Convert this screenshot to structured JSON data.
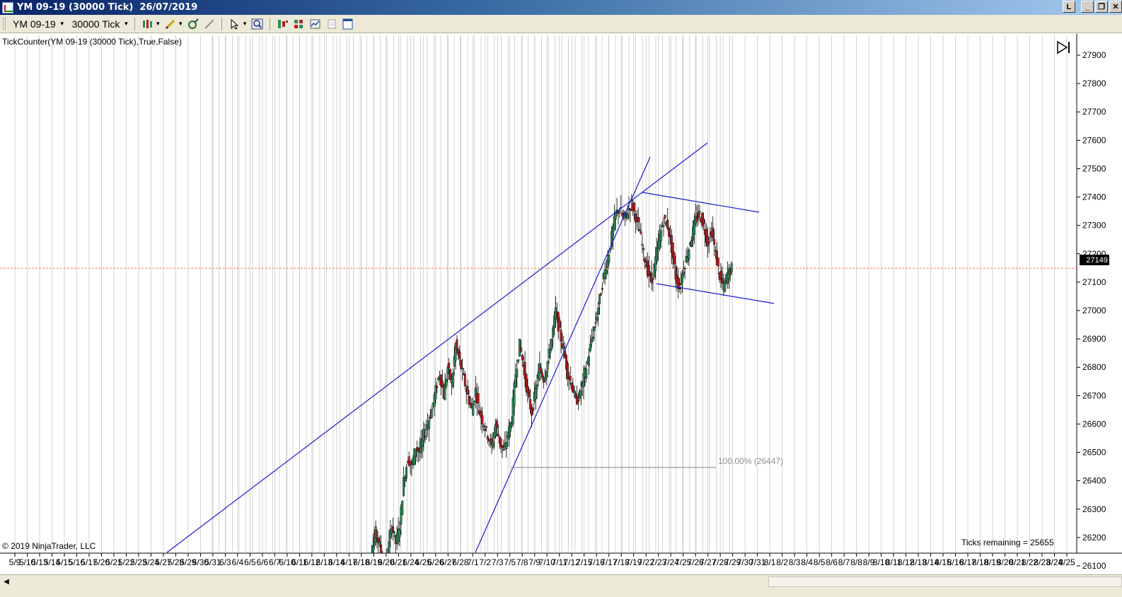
{
  "window": {
    "title": "YM 09-19 (30000 Tick)  26/07/2019",
    "buttons": [
      "L",
      "_",
      "❐",
      "✕"
    ]
  },
  "toolbar": {
    "instrument": "YM 09-19",
    "period": "30000 Tick",
    "icons": [
      "bars-type-icon",
      "draw-pencil-icon",
      "indicator-icon",
      "strategy-icon",
      "pointer-icon",
      "zoom-icon",
      "data-box-icon",
      "chart-trader-icon",
      "properties-icon",
      "template-icon",
      "window-icon"
    ]
  },
  "chart": {
    "indicator_label": "TickCounter(YM 09-19 (30000 Tick),True,False)",
    "copyright": "© 2019 NinjaTrader, LLC",
    "ticks_remaining": "Ticks remaining = 25655",
    "current_price": "27149",
    "fib_label": "100.00% (26447)",
    "colors": {
      "trendline": "#1a1ad2",
      "up_candle": "#2e8b57",
      "down_candle": "#b22222",
      "price_line": "#ff8040",
      "grid": "#c0c0c0"
    }
  },
  "chart_data": {
    "type": "candlestick",
    "price_axis": {
      "min": 26100,
      "max": 27900,
      "ticks": [
        "27900",
        "27800",
        "27700",
        "27600",
        "27500",
        "27400",
        "27300",
        "27200",
        "27100",
        "27000",
        "26900",
        "26800",
        "26700",
        "26600",
        "26500",
        "26400",
        "26300",
        "26200",
        "26100"
      ]
    },
    "date_axis": {
      "labels": [
        "5/9",
        "5/10",
        "5/13",
        "5/14",
        "5/15",
        "5/16",
        "5/17",
        "5/20",
        "5/21",
        "5/22",
        "5/23",
        "5/24",
        "5/27",
        "5/28",
        "5/29",
        "5/30",
        "5/31",
        "6/3",
        "6/4",
        "6/5",
        "6/6",
        "6/7",
        "6/10",
        "6/11",
        "6/12",
        "6/13",
        "6/14",
        "6/17",
        "6/18",
        "6/19",
        "6/20",
        "6/21",
        "6/24",
        "6/25",
        "6/26",
        "6/27",
        "6/28",
        "7/1",
        "7/2",
        "7/3",
        "7/5",
        "7/8",
        "7/9",
        "7/10",
        "7/11",
        "7/12",
        "7/15",
        "7/16",
        "7/17",
        "7/18",
        "7/19",
        "7/22",
        "7/23",
        "7/24",
        "7/25",
        "7/26",
        "7/27",
        "7/28",
        "7/29",
        "7/30",
        "7/31",
        "8/1",
        "8/2",
        "8/3",
        "8/4",
        "8/5",
        "8/6",
        "8/7",
        "8/8",
        "8/9",
        "8/10",
        "8/11",
        "8/12",
        "8/13",
        "8/14",
        "8/15",
        "8/16",
        "8/17",
        "8/18",
        "8/19",
        "8/20",
        "8/21",
        "8/22",
        "8/23",
        "8/24",
        "8/25"
      ]
    },
    "last_price": 27149,
    "fibonacci_level": 26447,
    "price_path": [
      26060,
      26080,
      26150,
      26220,
      26170,
      26100,
      26140,
      26250,
      26180,
      26240,
      26400,
      26480,
      26450,
      26520,
      26500,
      26560,
      26600,
      26650,
      26720,
      26780,
      26700,
      26800,
      26740,
      26880,
      26820,
      26760,
      26700,
      26650,
      26720,
      26640,
      26600,
      26560,
      26520,
      26600,
      26540,
      26500,
      26560,
      26620,
      26780,
      26880,
      26800,
      26700,
      26640,
      26720,
      26800,
      26760,
      26820,
      26900,
      27000,
      26920,
      26860,
      26780,
      26740,
      26680,
      26700,
      26760,
      26820,
      26900,
      26960,
      27040,
      27120,
      27180,
      27260,
      27340,
      27360,
      27320,
      27350,
      27380,
      27330,
      27280,
      27200,
      27140,
      27100,
      27180,
      27260,
      27320,
      27300,
      27220,
      27120,
      27080,
      27150,
      27200,
      27260,
      27320,
      27340,
      27300,
      27240,
      27280,
      27200,
      27120,
      27080,
      27130,
      27149
    ]
  }
}
